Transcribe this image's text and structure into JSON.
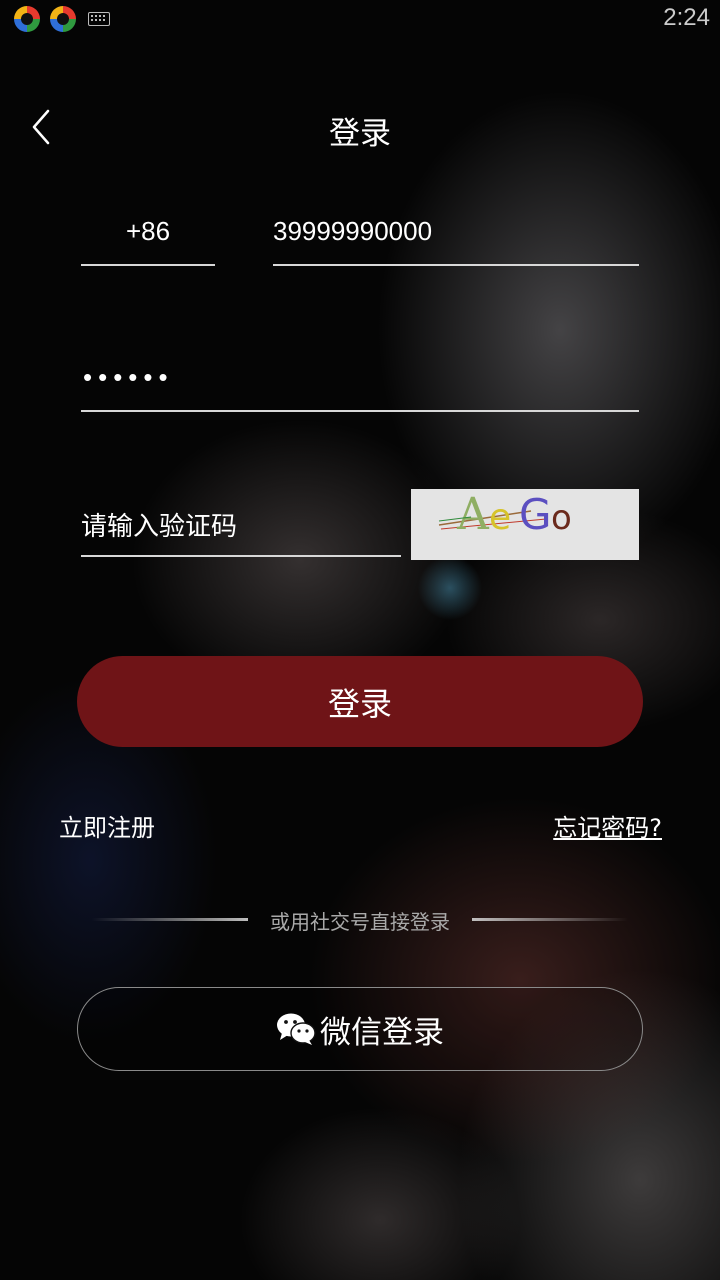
{
  "status_bar": {
    "time": "2:24",
    "icons": [
      "app-icon",
      "app-icon",
      "keyboard-icon"
    ]
  },
  "header": {
    "back_icon": "chevron-left-icon",
    "title": "登录"
  },
  "form": {
    "country_code": "+86",
    "phone_value": "39999990000",
    "password_value": "••••••",
    "captcha_placeholder": "请输入验证码",
    "captcha_image_text": "AeGo"
  },
  "actions": {
    "login_label": "登录",
    "register_label": "立即注册",
    "forgot_label": "忘记密码?"
  },
  "social": {
    "divider_label": "或用社交号直接登录",
    "wechat_icon": "wechat-icon",
    "wechat_label": "微信登录"
  },
  "colors": {
    "login_button": "#6f1417",
    "background": "#050505"
  }
}
